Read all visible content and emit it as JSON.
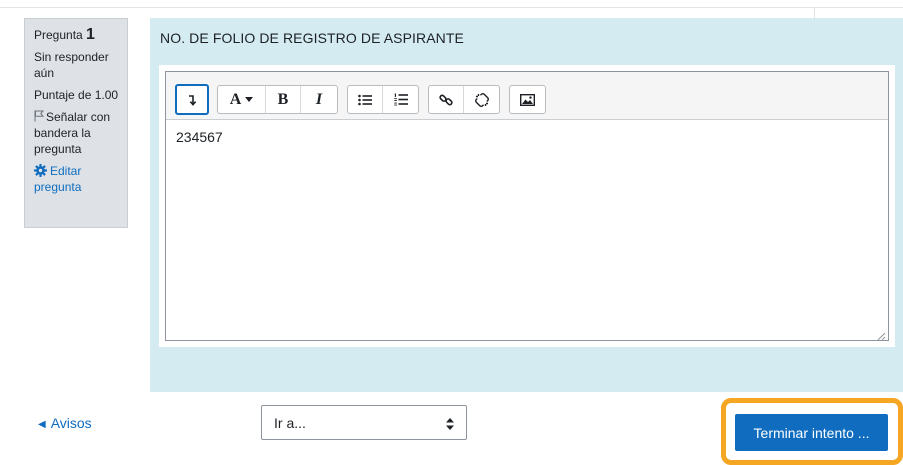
{
  "question_info": {
    "number_label": "Pregunta",
    "number": "1",
    "state": "Sin responder aún",
    "grade": "Puntaje de 1.00",
    "flag_label": "Señalar con bandera la pregunta",
    "edit_label": "Editar pregunta"
  },
  "question": {
    "text": "NO. DE FOLIO DE REGISTRO DE ASPIRANTE",
    "answer": "234567"
  },
  "toolbar": {
    "collapse_icon": "collapse-icon",
    "style_label": "A",
    "bold_label": "B",
    "italic_label": "I",
    "icons": [
      "unordered-list-icon",
      "ordered-list-icon",
      "link-icon",
      "unlink-icon",
      "image-icon"
    ]
  },
  "navigation": {
    "prev_label": "Avisos",
    "jump_label": "Ir a...",
    "finish_label": "Terminar intento ..."
  },
  "colors": {
    "content_bg": "#d4ebf2",
    "info_bg": "#dee2e6",
    "primary": "#0f6cbf",
    "highlight": "#f5a623"
  }
}
